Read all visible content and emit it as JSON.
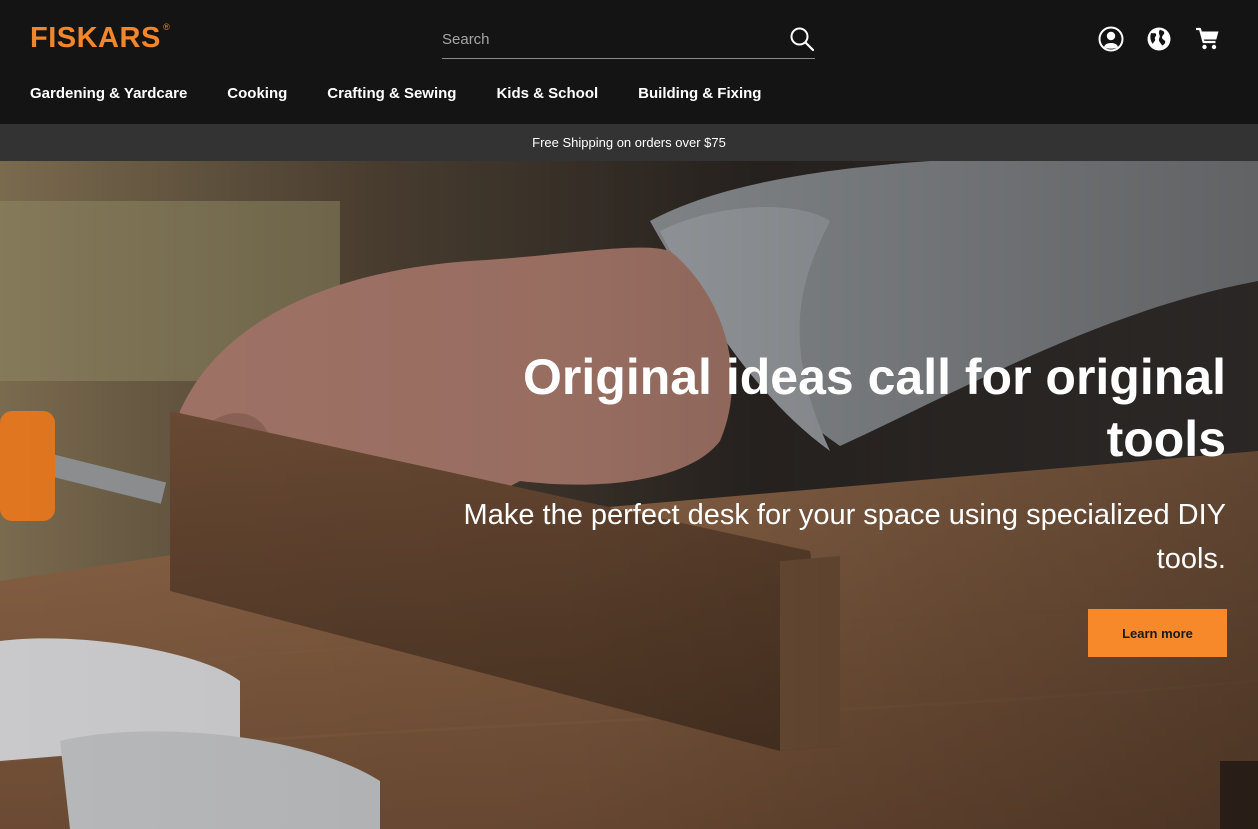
{
  "brand": {
    "logo_text": "FISKARS",
    "logo_mark": "®",
    "accent_color": "#f4862a"
  },
  "search": {
    "placeholder": "Search",
    "icon": "search-icon"
  },
  "header_icons": [
    {
      "name": "account-icon"
    },
    {
      "name": "globe-icon"
    },
    {
      "name": "cart-icon"
    }
  ],
  "nav": {
    "items": [
      {
        "label": "Gardening & Yardcare"
      },
      {
        "label": "Cooking"
      },
      {
        "label": "Crafting & Sewing"
      },
      {
        "label": "Kids & School"
      },
      {
        "label": "Building & Fixing"
      }
    ]
  },
  "promo": {
    "text": "Free Shipping on orders over $75"
  },
  "hero": {
    "headline": "Original ideas call for original tools",
    "subheadline": "Make the perfect desk for your space using specialized DIY tools.",
    "cta_label": "Learn more",
    "cta_color": "#f7892a"
  }
}
